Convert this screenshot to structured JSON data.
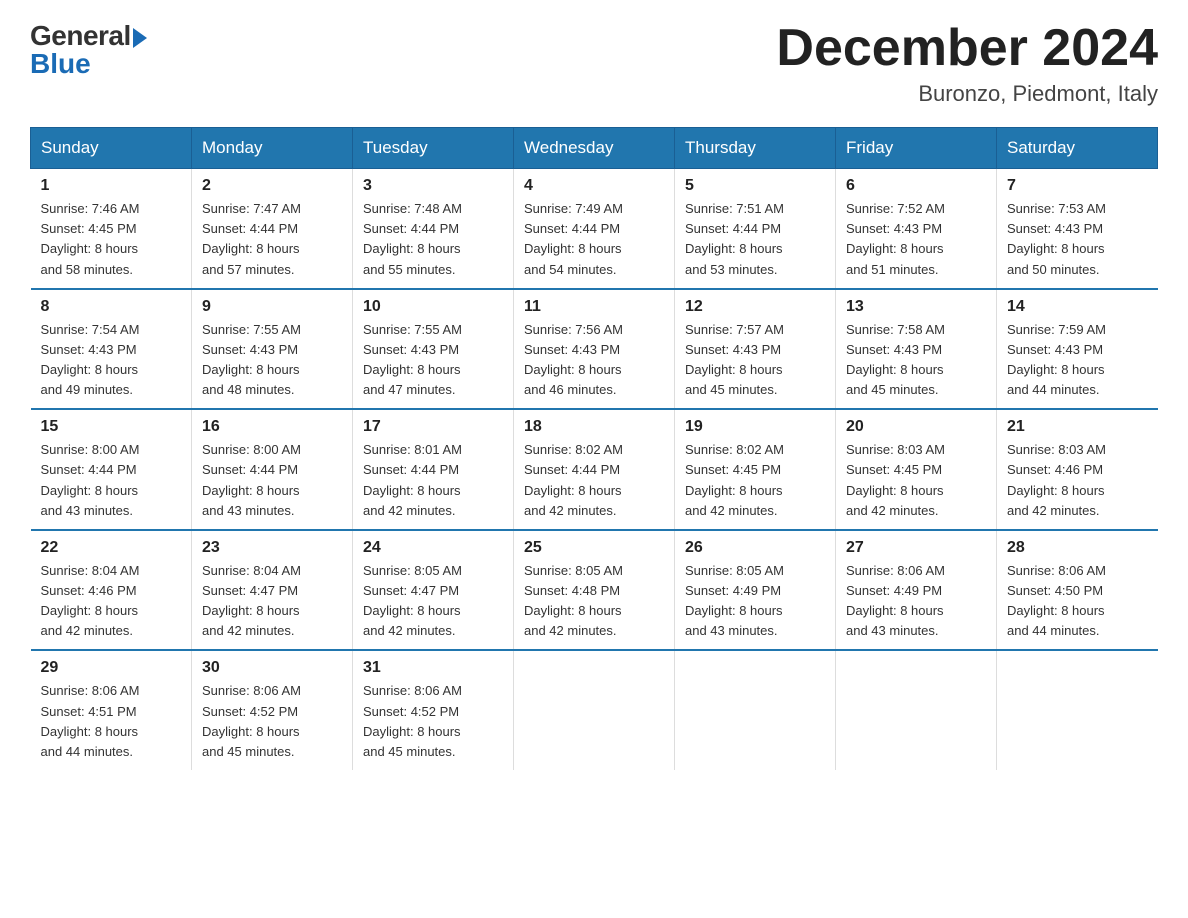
{
  "logo": {
    "general": "General",
    "blue": "Blue"
  },
  "title": "December 2024",
  "location": "Buronzo, Piedmont, Italy",
  "days_of_week": [
    "Sunday",
    "Monday",
    "Tuesday",
    "Wednesday",
    "Thursday",
    "Friday",
    "Saturday"
  ],
  "weeks": [
    [
      {
        "day": "1",
        "sunrise": "7:46 AM",
        "sunset": "4:45 PM",
        "daylight": "8 hours and 58 minutes."
      },
      {
        "day": "2",
        "sunrise": "7:47 AM",
        "sunset": "4:44 PM",
        "daylight": "8 hours and 57 minutes."
      },
      {
        "day": "3",
        "sunrise": "7:48 AM",
        "sunset": "4:44 PM",
        "daylight": "8 hours and 55 minutes."
      },
      {
        "day": "4",
        "sunrise": "7:49 AM",
        "sunset": "4:44 PM",
        "daylight": "8 hours and 54 minutes."
      },
      {
        "day": "5",
        "sunrise": "7:51 AM",
        "sunset": "4:44 PM",
        "daylight": "8 hours and 53 minutes."
      },
      {
        "day": "6",
        "sunrise": "7:52 AM",
        "sunset": "4:43 PM",
        "daylight": "8 hours and 51 minutes."
      },
      {
        "day": "7",
        "sunrise": "7:53 AM",
        "sunset": "4:43 PM",
        "daylight": "8 hours and 50 minutes."
      }
    ],
    [
      {
        "day": "8",
        "sunrise": "7:54 AM",
        "sunset": "4:43 PM",
        "daylight": "8 hours and 49 minutes."
      },
      {
        "day": "9",
        "sunrise": "7:55 AM",
        "sunset": "4:43 PM",
        "daylight": "8 hours and 48 minutes."
      },
      {
        "day": "10",
        "sunrise": "7:55 AM",
        "sunset": "4:43 PM",
        "daylight": "8 hours and 47 minutes."
      },
      {
        "day": "11",
        "sunrise": "7:56 AM",
        "sunset": "4:43 PM",
        "daylight": "8 hours and 46 minutes."
      },
      {
        "day": "12",
        "sunrise": "7:57 AM",
        "sunset": "4:43 PM",
        "daylight": "8 hours and 45 minutes."
      },
      {
        "day": "13",
        "sunrise": "7:58 AM",
        "sunset": "4:43 PM",
        "daylight": "8 hours and 45 minutes."
      },
      {
        "day": "14",
        "sunrise": "7:59 AM",
        "sunset": "4:43 PM",
        "daylight": "8 hours and 44 minutes."
      }
    ],
    [
      {
        "day": "15",
        "sunrise": "8:00 AM",
        "sunset": "4:44 PM",
        "daylight": "8 hours and 43 minutes."
      },
      {
        "day": "16",
        "sunrise": "8:00 AM",
        "sunset": "4:44 PM",
        "daylight": "8 hours and 43 minutes."
      },
      {
        "day": "17",
        "sunrise": "8:01 AM",
        "sunset": "4:44 PM",
        "daylight": "8 hours and 42 minutes."
      },
      {
        "day": "18",
        "sunrise": "8:02 AM",
        "sunset": "4:44 PM",
        "daylight": "8 hours and 42 minutes."
      },
      {
        "day": "19",
        "sunrise": "8:02 AM",
        "sunset": "4:45 PM",
        "daylight": "8 hours and 42 minutes."
      },
      {
        "day": "20",
        "sunrise": "8:03 AM",
        "sunset": "4:45 PM",
        "daylight": "8 hours and 42 minutes."
      },
      {
        "day": "21",
        "sunrise": "8:03 AM",
        "sunset": "4:46 PM",
        "daylight": "8 hours and 42 minutes."
      }
    ],
    [
      {
        "day": "22",
        "sunrise": "8:04 AM",
        "sunset": "4:46 PM",
        "daylight": "8 hours and 42 minutes."
      },
      {
        "day": "23",
        "sunrise": "8:04 AM",
        "sunset": "4:47 PM",
        "daylight": "8 hours and 42 minutes."
      },
      {
        "day": "24",
        "sunrise": "8:05 AM",
        "sunset": "4:47 PM",
        "daylight": "8 hours and 42 minutes."
      },
      {
        "day": "25",
        "sunrise": "8:05 AM",
        "sunset": "4:48 PM",
        "daylight": "8 hours and 42 minutes."
      },
      {
        "day": "26",
        "sunrise": "8:05 AM",
        "sunset": "4:49 PM",
        "daylight": "8 hours and 43 minutes."
      },
      {
        "day": "27",
        "sunrise": "8:06 AM",
        "sunset": "4:49 PM",
        "daylight": "8 hours and 43 minutes."
      },
      {
        "day": "28",
        "sunrise": "8:06 AM",
        "sunset": "4:50 PM",
        "daylight": "8 hours and 44 minutes."
      }
    ],
    [
      {
        "day": "29",
        "sunrise": "8:06 AM",
        "sunset": "4:51 PM",
        "daylight": "8 hours and 44 minutes."
      },
      {
        "day": "30",
        "sunrise": "8:06 AM",
        "sunset": "4:52 PM",
        "daylight": "8 hours and 45 minutes."
      },
      {
        "day": "31",
        "sunrise": "8:06 AM",
        "sunset": "4:52 PM",
        "daylight": "8 hours and 45 minutes."
      },
      null,
      null,
      null,
      null
    ]
  ],
  "labels": {
    "sunrise": "Sunrise:",
    "sunset": "Sunset:",
    "daylight": "Daylight:"
  }
}
